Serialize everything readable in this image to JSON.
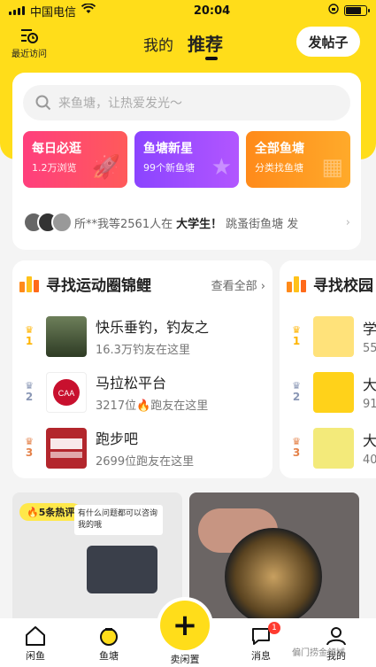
{
  "status_bar": {
    "carrier": "中国电信",
    "time": "20:04"
  },
  "header": {
    "recent_label": "最近访问",
    "tabs": [
      "我的",
      "推荐"
    ],
    "active_tab": "推荐",
    "post_button": "发帖子"
  },
  "search": {
    "placeholder": "来鱼塘，让热爱发光～"
  },
  "tiles": [
    {
      "title": "每日必逛",
      "subtitle": "1.2万浏览"
    },
    {
      "title": "鱼塘新星",
      "subtitle": "99个新鱼塘"
    },
    {
      "title": "全部鱼塘",
      "subtitle": "分类找鱼塘"
    }
  ],
  "ticker": {
    "prefix": "所**我等2561人在",
    "highlight": "大学生！",
    "suffix": "跳蚤街鱼塘 发"
  },
  "ponds": [
    {
      "title": "寻找运动圈锦鲤",
      "view_all": "查看全部",
      "items": [
        {
          "rank": "1",
          "name": "快乐垂钓，钓友之",
          "sub": "16.3万钓友在这里"
        },
        {
          "rank": "2",
          "name": "马拉松平台",
          "sub": "3217位🔥跑友在这里"
        },
        {
          "rank": "3",
          "name": "跑步吧",
          "sub": "2699位跑友在这里"
        }
      ]
    },
    {
      "title": "寻找校园",
      "items": [
        {
          "rank": "1",
          "name": "学",
          "sub": "55"
        },
        {
          "rank": "2",
          "name": "大",
          "sub": "91"
        },
        {
          "rank": "3",
          "name": "大",
          "sub": "40"
        }
      ]
    }
  ],
  "feed": {
    "hot_badge": "5条热评",
    "chat_text": "有什么问题都可以咨询我的哦"
  },
  "tabbar": {
    "items": [
      "闲鱼",
      "鱼塘",
      "卖闲置",
      "消息",
      "我的"
    ],
    "message_badge": "1"
  },
  "watermark": "偏门捞金领域",
  "colors": {
    "brand_yellow": "#ffdd1a"
  }
}
